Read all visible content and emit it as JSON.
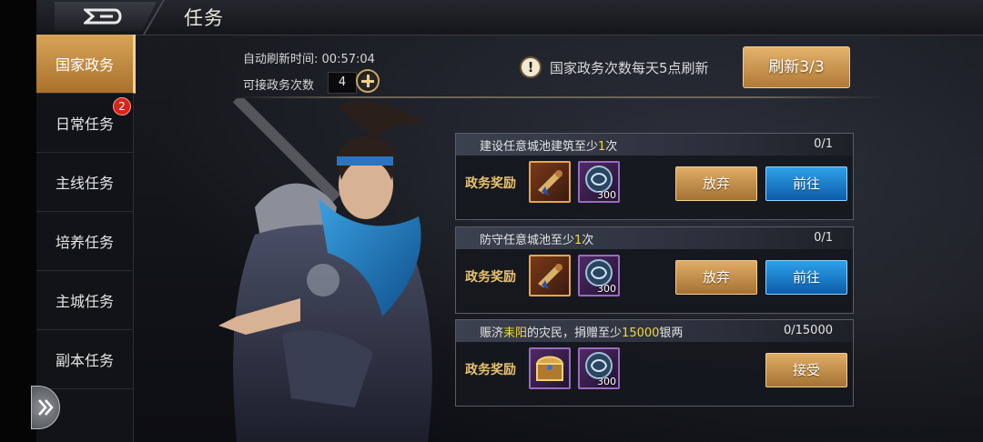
{
  "header": {
    "title": "任务"
  },
  "sidebar": {
    "tabs": [
      {
        "label": "国家政务",
        "active": true
      },
      {
        "label": "日常任务",
        "badge": "2"
      },
      {
        "label": "主线任务"
      },
      {
        "label": "培养任务"
      },
      {
        "label": "主城任务"
      },
      {
        "label": "副本任务"
      }
    ]
  },
  "info": {
    "refresh_time_label": "自动刷新时间:",
    "refresh_time": "00:57:04",
    "available_label": "可接政务次数",
    "available_count": "4",
    "notice": "国家政务次数每天5点刷新",
    "refresh_button": "刷新3/3"
  },
  "tasks": [
    {
      "title_pre": "建设任意城池建筑至少",
      "title_hl": "1",
      "title_post": "次",
      "progress": "0/1",
      "reward_label": "政务奖励",
      "items": [
        {
          "icon": "horn-scroll-icon",
          "qty": ""
        },
        {
          "icon": "dragon-coin-icon",
          "qty": "300"
        }
      ],
      "buttons": [
        "放弃",
        "前往"
      ]
    },
    {
      "title_pre": "防守任意城池至少",
      "title_hl": "1",
      "title_post": "次",
      "progress": "0/1",
      "reward_label": "政务奖励",
      "items": [
        {
          "icon": "horn-scroll-icon",
          "qty": ""
        },
        {
          "icon": "dragon-coin-icon",
          "qty": "300"
        }
      ],
      "buttons": [
        "放弃",
        "前往"
      ]
    },
    {
      "title_pre": "赈济",
      "title_hl": "耒阳",
      "title_mid": "的灾民，捐赠至少",
      "title_hl2": "15000",
      "title_post": "银两",
      "progress": "0/15000",
      "reward_label": "政务奖励",
      "items": [
        {
          "icon": "treasure-chest-icon",
          "qty": ""
        },
        {
          "icon": "dragon-coin-icon",
          "qty": "300"
        }
      ],
      "buttons": [
        "接受"
      ]
    }
  ],
  "colors": {
    "accent_gold": "#d7a458",
    "accent_blue": "#1a7fd0",
    "highlight": "#f4d63a"
  }
}
